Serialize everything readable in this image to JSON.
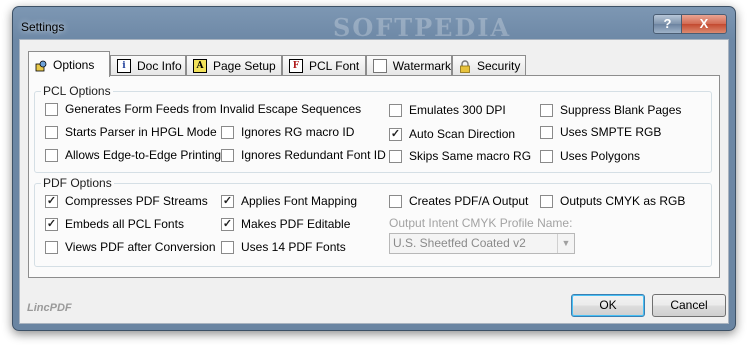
{
  "window": {
    "title": "Settings",
    "watermark": "SOFTPEDIA"
  },
  "title_buttons": {
    "help": "?",
    "close": "X"
  },
  "tabs": [
    {
      "label": "Options",
      "icon": "options-icon",
      "glyph": ""
    },
    {
      "label": "Doc Info",
      "icon": "info-icon",
      "glyph": "i"
    },
    {
      "label": "Page Setup",
      "icon": "page-setup-icon",
      "glyph": "A"
    },
    {
      "label": "PCL Font",
      "icon": "font-icon",
      "glyph": "F"
    },
    {
      "label": "Watermark",
      "icon": "watermark-icon",
      "glyph": ""
    },
    {
      "label": "Security",
      "icon": "lock-icon",
      "glyph": ""
    }
  ],
  "pcl_options": {
    "legend": "PCL Options",
    "items": [
      {
        "label": "Generates Form Feeds from Invalid Escape Sequences",
        "checked": false
      },
      {
        "label": "Starts Parser in HPGL Mode",
        "checked": false
      },
      {
        "label": "Allows Edge-to-Edge Printing",
        "checked": false
      },
      {
        "label": "Ignores RG macro ID",
        "checked": false
      },
      {
        "label": "Ignores Redundant Font ID",
        "checked": false
      },
      {
        "label": "Emulates 300 DPI",
        "checked": false
      },
      {
        "label": "Auto Scan Direction",
        "checked": true
      },
      {
        "label": "Skips Same macro RG",
        "checked": false
      },
      {
        "label": "Suppress Blank Pages",
        "checked": false
      },
      {
        "label": "Uses SMPTE RGB",
        "checked": false
      },
      {
        "label": "Uses Polygons",
        "checked": false
      }
    ]
  },
  "pdf_options": {
    "legend": "PDF Options",
    "items": [
      {
        "label": "Compresses PDF Streams",
        "checked": true
      },
      {
        "label": "Embeds all PCL Fonts",
        "checked": true
      },
      {
        "label": "Views PDF after Conversion",
        "checked": false
      },
      {
        "label": "Applies Font Mapping",
        "checked": true
      },
      {
        "label": "Makes PDF Editable",
        "checked": true
      },
      {
        "label": "Uses 14 PDF Fonts",
        "checked": false
      },
      {
        "label": "Creates PDF/A Output",
        "checked": false
      },
      {
        "label": "Outputs CMYK as RGB",
        "checked": false
      }
    ],
    "profile_label": "Output Intent CMYK Profile Name:",
    "profile_value": "U.S. Sheetfed Coated v2"
  },
  "footer": {
    "brand": "LincPDF",
    "ok": "OK",
    "cancel": "Cancel"
  },
  "colors": {
    "titlebar": "#6d88a6",
    "close": "#c34a30",
    "face": "#f0f0f0"
  }
}
